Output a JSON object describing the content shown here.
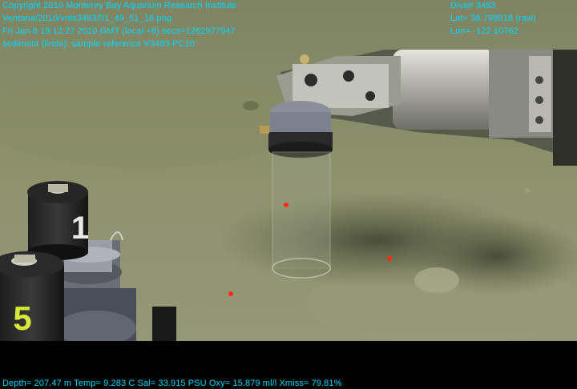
{
  "overlay": {
    "line1": "Copyright 2010 Monterey Bay Aquarium Research Institute",
    "line2": "Ventana/2010/vnts3483/01_49_51_16.png",
    "line3": "Fri Jan  8 19:12:27 2010 GMT (local +8)  secs=1262977947",
    "line4": "sediment (linda): sample-reference V3483 PC10",
    "dive": "Dive# 3483",
    "lat": "Lat= 36.798918 (raw)",
    "lon": "Lon= -122.10762",
    "sensors": "Depth= 207.47 m  Temp= 9.283 C  Sal= 33.915 PSU  Oxy= 15.879 ml/l  Xmiss= 79.81%"
  },
  "tube_labels": {
    "left_tube": "1",
    "front_tube": "5"
  },
  "colors": {
    "overlay_text": "#00d8ff",
    "sediment": "#8c906a",
    "laser": "#ff2a1a"
  }
}
